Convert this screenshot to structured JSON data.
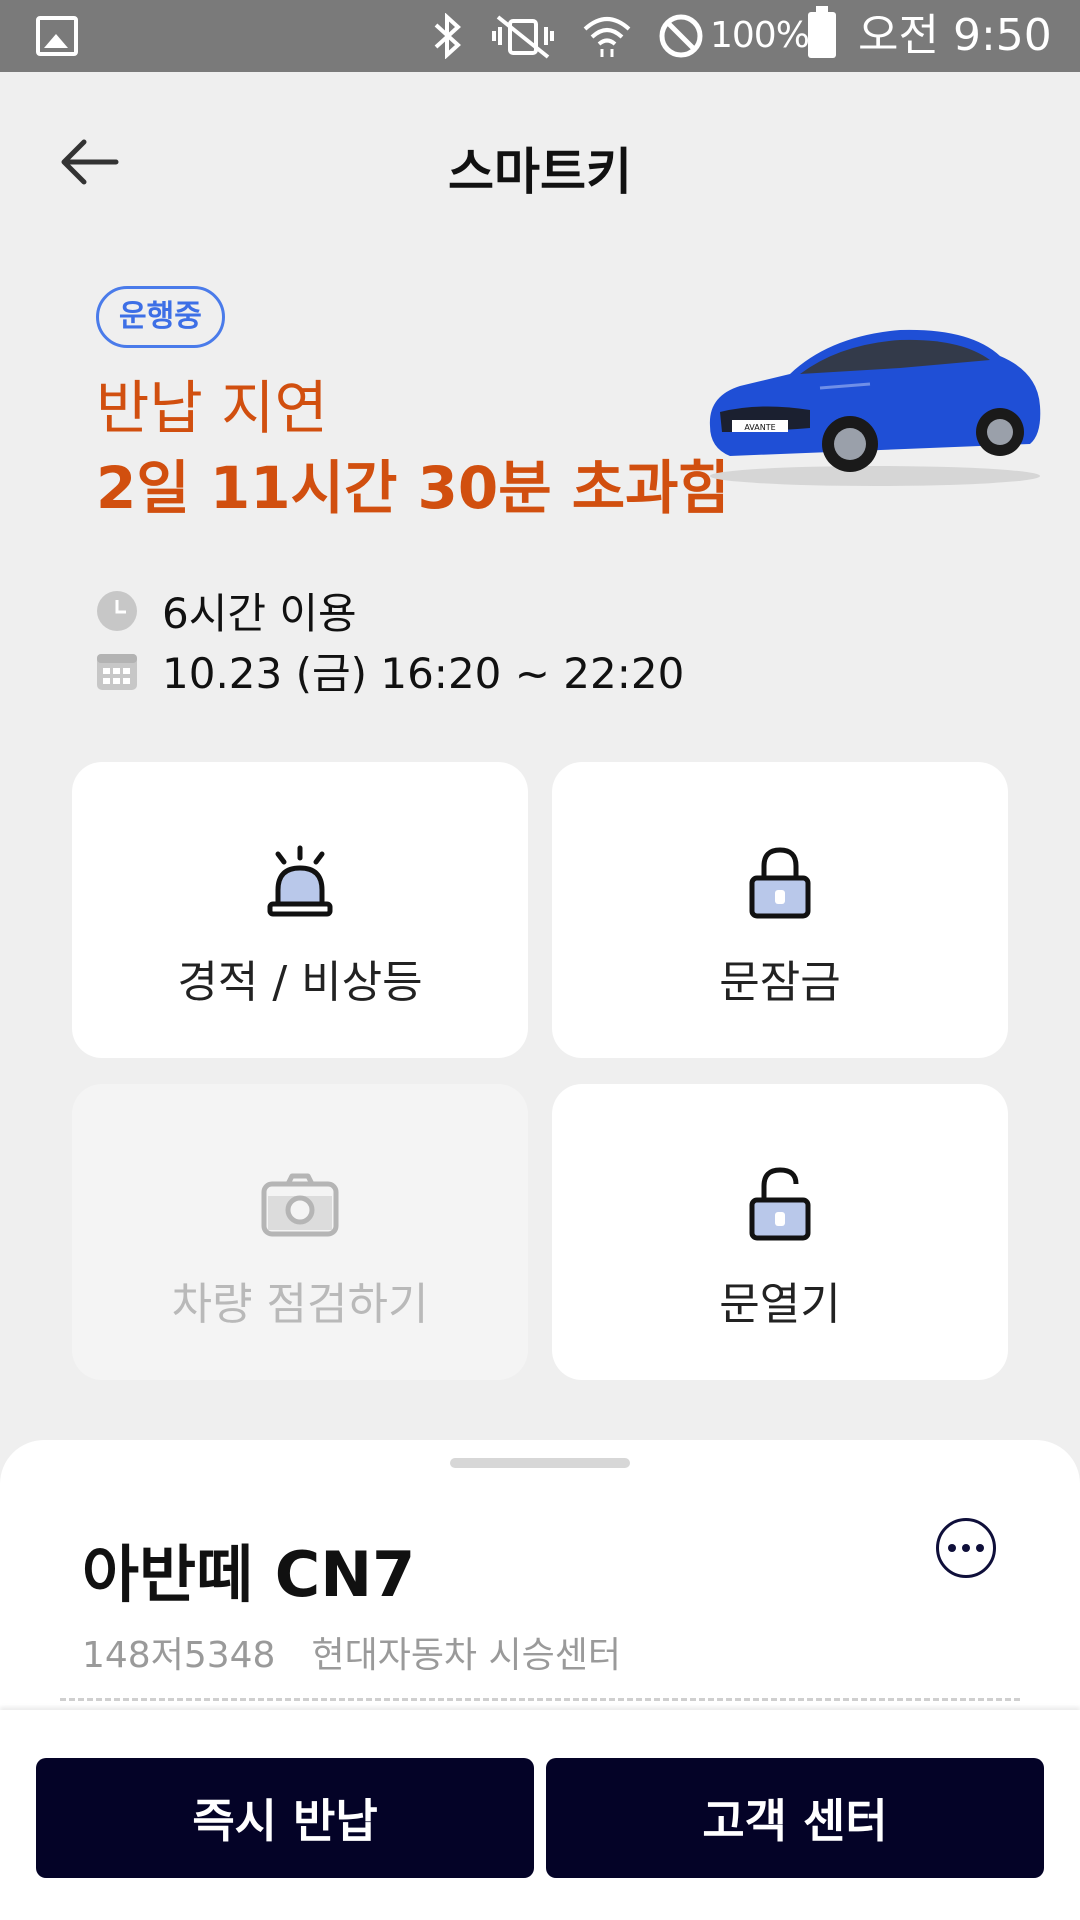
{
  "status_bar": {
    "battery_percent": "100%",
    "time": "오전 9:50",
    "icons": [
      "gallery-icon",
      "bluetooth-icon",
      "vibrate-off-icon",
      "wifi-icon",
      "do-not-disturb-icon",
      "battery-icon"
    ]
  },
  "header": {
    "title": "스마트키",
    "back_icon": "arrow-left-icon"
  },
  "rental_status": {
    "badge": "운행중",
    "delay_title": "반납 지연",
    "delay_detail": "2일 11시간 30분  초과함",
    "usage_duration": "6시간 이용",
    "usage_period": "10.23 (금) 16:20 ~ 22:20",
    "colors": {
      "badge": "#3d6fe6",
      "delay": "#d14f0f"
    }
  },
  "controls": [
    {
      "label": "경적 / 비상등",
      "icon": "siren-icon",
      "enabled": true
    },
    {
      "label": "문잠금",
      "icon": "lock-icon",
      "enabled": true
    },
    {
      "label": "차량 점검하기",
      "icon": "camera-icon",
      "enabled": false
    },
    {
      "label": "문열기",
      "icon": "unlock-icon",
      "enabled": true
    }
  ],
  "vehicle": {
    "name": "아반떼 CN7",
    "plate": "148저5348",
    "location": "현대자동차 시승센터",
    "more_icon": "more-horizontal-icon",
    "color": "#1f4fd6"
  },
  "car_image_plate": "AVANTE",
  "actions": {
    "return_now": "즉시 반납",
    "customer_center": "고객 센터",
    "button_color": "#040327"
  }
}
